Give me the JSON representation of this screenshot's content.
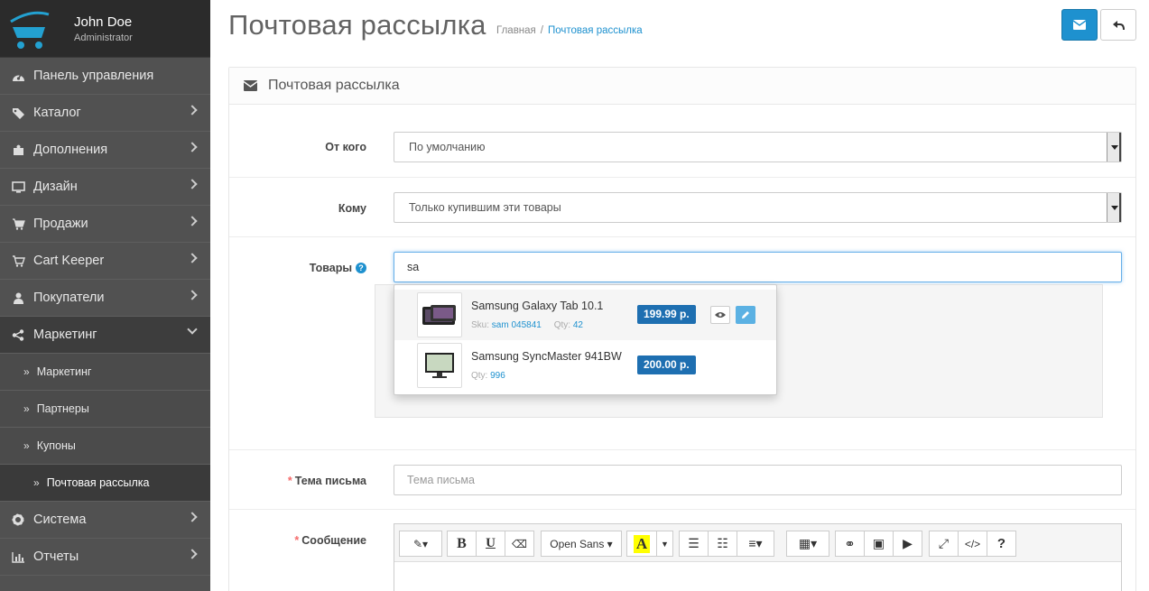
{
  "user": {
    "name": "John Doe",
    "role": "Administrator"
  },
  "nav": [
    {
      "label": "Панель управления",
      "icon": "dashboard-icon"
    },
    {
      "label": "Каталог",
      "icon": "tags-icon"
    },
    {
      "label": "Дополнения",
      "icon": "puzzle-icon"
    },
    {
      "label": "Дизайн",
      "icon": "desktop-icon"
    },
    {
      "label": "Продажи",
      "icon": "cart-icon"
    },
    {
      "label": "Cart Keeper",
      "icon": "cart-plus-icon"
    },
    {
      "label": "Покупатели",
      "icon": "user-icon"
    },
    {
      "label": "Маркетинг",
      "icon": "share-icon"
    },
    {
      "label": "Система",
      "icon": "cog-icon"
    },
    {
      "label": "Отчеты",
      "icon": "bar-chart-icon"
    }
  ],
  "subnav": [
    "Маркетинг",
    "Партнеры",
    "Купоны",
    "Почтовая рассылка"
  ],
  "page": {
    "title": "Почтовая рассылка"
  },
  "breadcrumb": {
    "home": "Главная",
    "current": "Почтовая рассылка"
  },
  "panel": {
    "title": "Почтовая рассылка"
  },
  "form": {
    "from_label": "От кого",
    "from_value": "По умолчанию",
    "to_label": "Кому",
    "to_value": "Только купившим эти товары",
    "products_label": "Товары",
    "products_value": "sa",
    "subject_label": "Тема письма",
    "subject_placeholder": "Тема письма",
    "message_label": "Сообщение",
    "required_mark": "*",
    "help_mark": "?"
  },
  "autocomplete": [
    {
      "name": "Samsung Galaxy Tab 10.1",
      "sku_label": "Sku:",
      "sku": "sam 045841",
      "qty_label": "Qty:",
      "qty": "42",
      "price": "199.99 р."
    },
    {
      "name": "Samsung SyncMaster 941BW",
      "qty_label": "Qty:",
      "qty": "996",
      "price": "200.00 р."
    }
  ],
  "editor": {
    "font": "Open Sans",
    "help": "?"
  },
  "colors": {
    "sidebar": "#515151",
    "accent": "#1e91cf",
    "price": "#1e6fb1"
  }
}
